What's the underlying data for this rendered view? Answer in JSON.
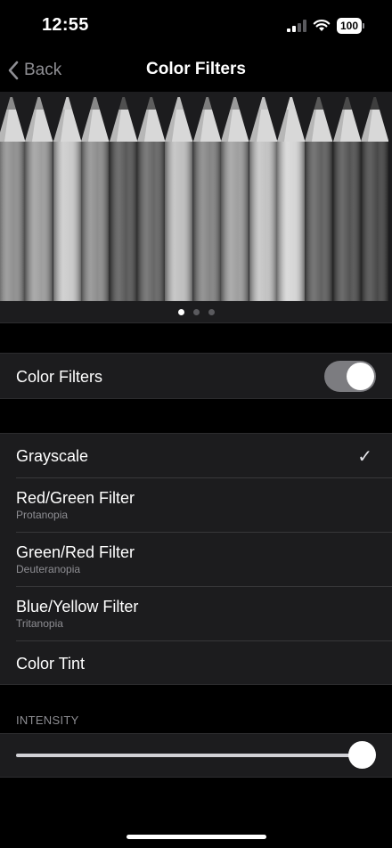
{
  "status_bar": {
    "time": "12:55",
    "battery": "100",
    "icons": [
      "signal-icon",
      "wifi-icon",
      "battery-icon"
    ]
  },
  "nav": {
    "back_label": "Back",
    "title": "Color Filters"
  },
  "preview": {
    "pencil_shades": [
      "#8a8a8a",
      "#999999",
      "#c8c8c8",
      "#888888",
      "#505050",
      "#5e5e5e",
      "#bcbcbc",
      "#7e7e7e",
      "#9a9a9a",
      "#c0c0c0",
      "#d4d4d4",
      "#585858",
      "#4a4a4a",
      "#3e3e3e"
    ],
    "page_count": 3,
    "current_page": 1
  },
  "toggle_row": {
    "label": "Color Filters",
    "on": true
  },
  "filters": [
    {
      "title": "Grayscale",
      "subtitle": "",
      "selected": true
    },
    {
      "title": "Red/Green Filter",
      "subtitle": "Protanopia",
      "selected": false
    },
    {
      "title": "Green/Red Filter",
      "subtitle": "Deuteranopia",
      "selected": false
    },
    {
      "title": "Blue/Yellow Filter",
      "subtitle": "Tritanopia",
      "selected": false
    },
    {
      "title": "Color Tint",
      "subtitle": "",
      "selected": false
    }
  ],
  "intensity": {
    "label": "INTENSITY",
    "value": 1.0
  },
  "colors": {
    "background": "#000000",
    "cell": "#1c1c1e",
    "secondary_text": "#8e8e93",
    "toggle_on": "#7c7c80"
  }
}
